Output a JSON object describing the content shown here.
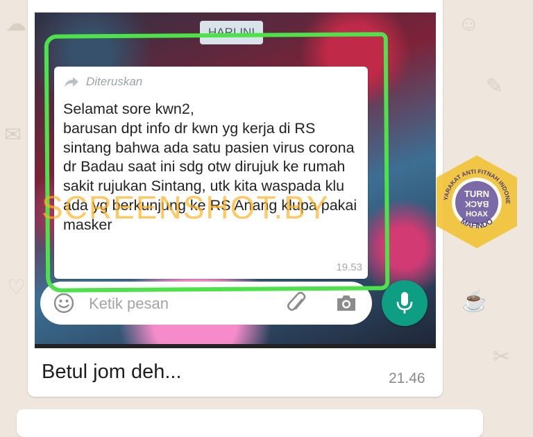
{
  "chat": {
    "date_chip": "HARI INI",
    "forwarded_label": "Diteruskan",
    "forwarded_message": "Selamat sore kwn2,\nbarusan dpt info dr kwn yg kerja di RS sintang bahwa ada satu pasien virus corona dr Badau saat ini sdg otw dirujuk ke rumah sakit rujukan Sintang, utk kita waspada klu ada yg berkunjung ke RS Anang klupa pakai masker",
    "forwarded_time": "19.53",
    "input_placeholder": "Ketik pesan",
    "reply_text": "Betul jom deh...",
    "reply_time": "21.46"
  },
  "overlay": {
    "watermark": "SCREENSHOT.BY",
    "badge_top_text": "MASYARAKAT ANTI FITNAH INDONESIA",
    "badge_bottom_text": "MAFINDO",
    "badge_center_line1": "TURN",
    "badge_center_line2": "BACK",
    "badge_center_line3": "HOAX"
  },
  "icons": {
    "forward": "forward-arrow-icon",
    "emoji": "emoji-icon",
    "attach": "paperclip-icon",
    "camera": "camera-icon",
    "mic": "microphone-icon"
  },
  "colors": {
    "wallpaper": "#efe7de",
    "highlight": "#4ee24a",
    "mic_button": "#0e9e84",
    "watermark": "#ffb01e",
    "badge_ring": "#f2c230",
    "badge_center": "#7b6aa8"
  }
}
